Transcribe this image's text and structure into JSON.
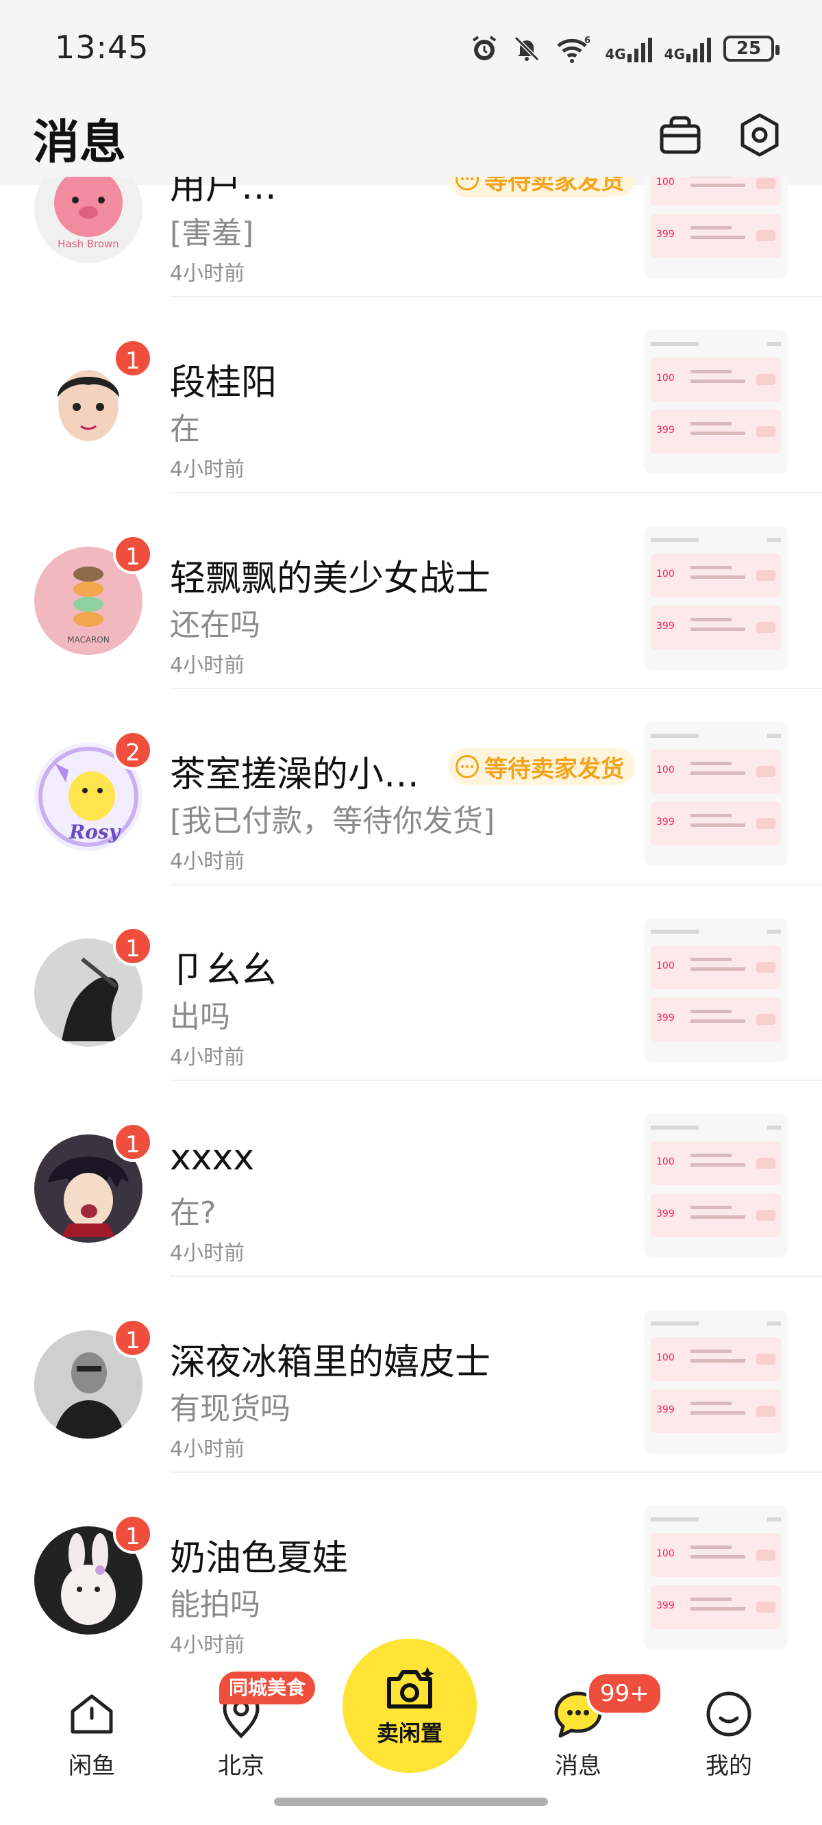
{
  "status_bar": {
    "time": "13:45",
    "net1": "4G",
    "net2": "4G",
    "wifi_sup": "6",
    "battery": "25"
  },
  "header": {
    "title": "消息"
  },
  "conversations": [
    {
      "name": "用户…",
      "message": "[害羞]",
      "time": "4小时前",
      "badge": "",
      "tag": "等待卖家发货",
      "avatar_color": "#f28aa0"
    },
    {
      "name": "段桂阳",
      "message": "在",
      "time": "4小时前",
      "badge": "1",
      "tag": "",
      "avatar_color": "#f0d6c4"
    },
    {
      "name": "轻飘飘的美少女战士",
      "message": "还在吗",
      "time": "4小时前",
      "badge": "1",
      "tag": "",
      "avatar_color": "#f2b8bf"
    },
    {
      "name": "茶室搓澡的小…",
      "message": "[我已付款，等待你发货]",
      "time": "4小时前",
      "badge": "2",
      "tag": "等待卖家发货",
      "avatar_color": "#e8dbff"
    },
    {
      "name": "卩幺幺",
      "message": "出吗",
      "time": "4小时前",
      "badge": "1",
      "tag": "",
      "avatar_color": "#5a5a5a"
    },
    {
      "name": "xxxx",
      "message": "在?",
      "time": "4小时前",
      "badge": "1",
      "tag": "",
      "avatar_color": "#3a3340"
    },
    {
      "name": "深夜冰箱里的嬉皮士",
      "message": "有现货吗",
      "time": "4小时前",
      "badge": "1",
      "tag": "",
      "avatar_color": "#9a9a9a"
    },
    {
      "name": "奶油色夏娃",
      "message": "能拍吗",
      "time": "4小时前",
      "badge": "1",
      "tag": "",
      "avatar_color": "#2a2a2a"
    }
  ],
  "thumb": {
    "price1": "100",
    "price2": "399"
  },
  "tabbar": {
    "home": "闲鱼",
    "city": "北京",
    "city_badge": "同城美食",
    "sell": "卖闲置",
    "messages": "消息",
    "messages_badge": "99+",
    "me": "我的"
  },
  "colors": {
    "accent": "#ffe435",
    "badge": "#ef4e3c",
    "tag_text": "#f3a31b",
    "tag_bg": "#fff4dc"
  }
}
